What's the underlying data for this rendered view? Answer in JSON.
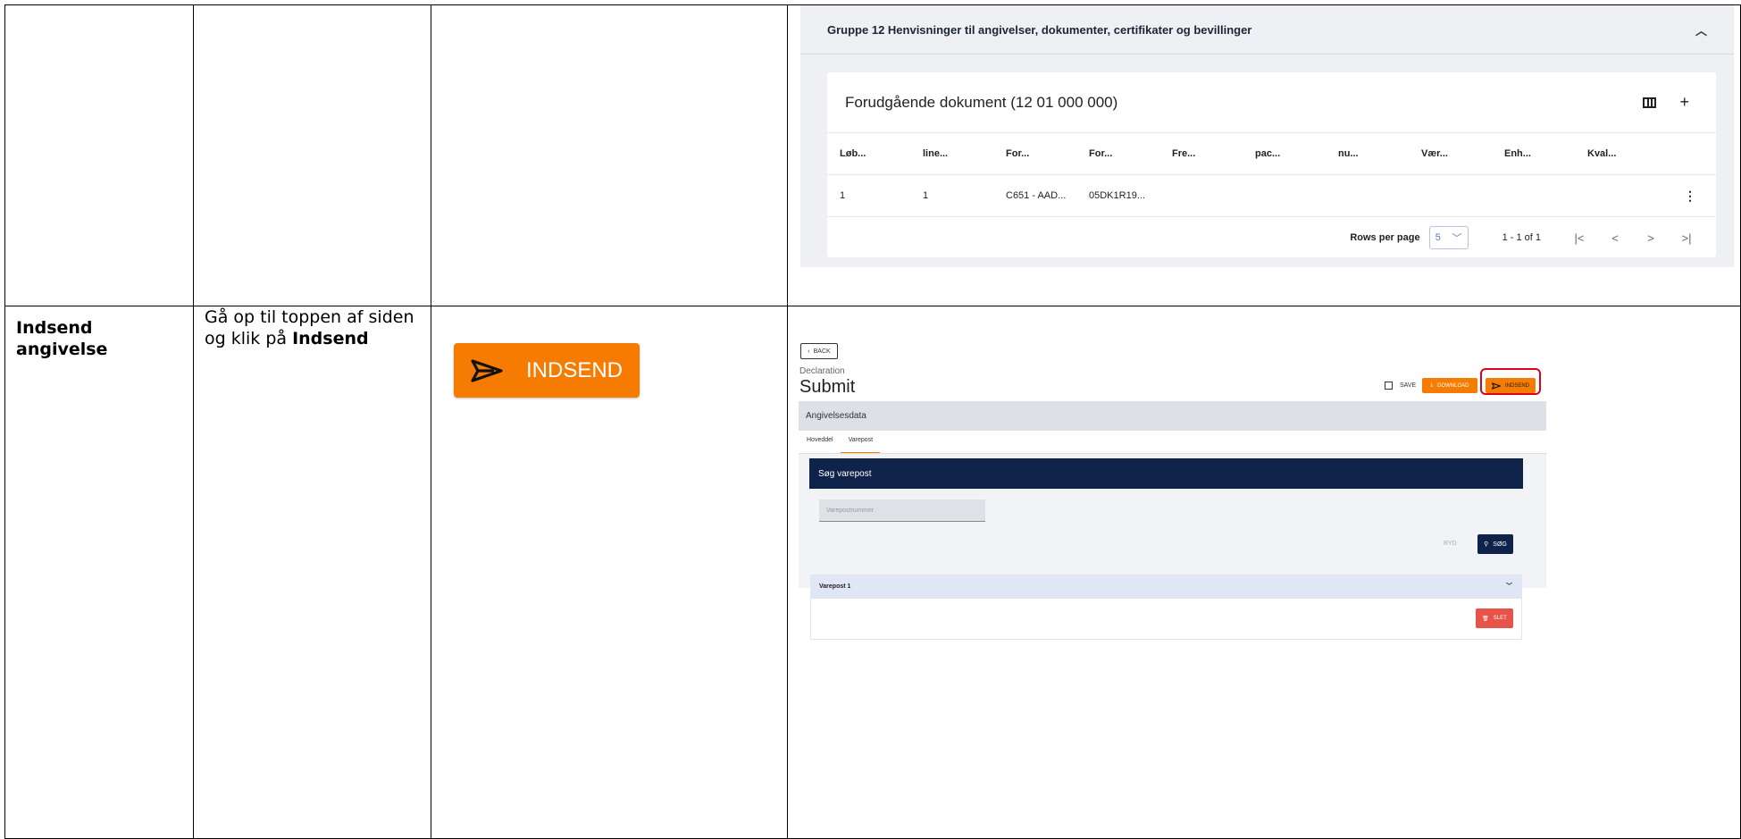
{
  "rows": [
    {
      "cell1_text": "",
      "cell2_text": "",
      "screenshot": {
        "group_header": "Gruppe 12 Henvisninger til angivelser, dokumenter, certifikater og bevillinger",
        "card_title": "Forudgående dokument (12 01 000 000)",
        "add_label": "+",
        "columns": [
          "Løb...",
          "line...",
          "For...",
          "For...",
          "Fre...",
          "pac...",
          "nu...",
          "Vær...",
          "Enh...",
          "Kval..."
        ],
        "data_row": [
          "1",
          "1",
          "C651 - AAD...",
          "05DK1R19...",
          "",
          "",
          "",
          "",
          "",
          ""
        ],
        "kebab": "⋮",
        "rows_per_page_label": "Rows per page",
        "rows_per_page_value": "5",
        "range_text": "1 - 1 of 1",
        "first_page": "|<",
        "prev_page": "<",
        "next_page": ">",
        "last_page": ">|"
      }
    },
    {
      "cell1_text": "Indsend angivelse",
      "cell2_text_prefix": "Gå op til toppen af siden og klik på ",
      "cell2_text_bold": "Indsend",
      "big_button_label": "INDSEND",
      "screenshot": {
        "back_label": "BACK",
        "declaration_label": "Declaration",
        "page_title": "Submit",
        "save_label": "SAVE",
        "download_label": "DOWNLOAD",
        "indsend_label": "INDSEND",
        "section_label": "Angivelsesdata",
        "tabs": [
          "Hoveddel",
          "Varepost"
        ],
        "search_title": "Søg varepost",
        "search_placeholder": "Varepostnummer",
        "ryd_label": "RYD",
        "sog_label": "SØG",
        "varepost_label": "Varepost 1",
        "slet_label": "SLET"
      }
    }
  ],
  "colors": {
    "accent": "#f57c00",
    "navy": "#0f2249",
    "highlight": "#e0001a",
    "delete": "#e8534a"
  }
}
